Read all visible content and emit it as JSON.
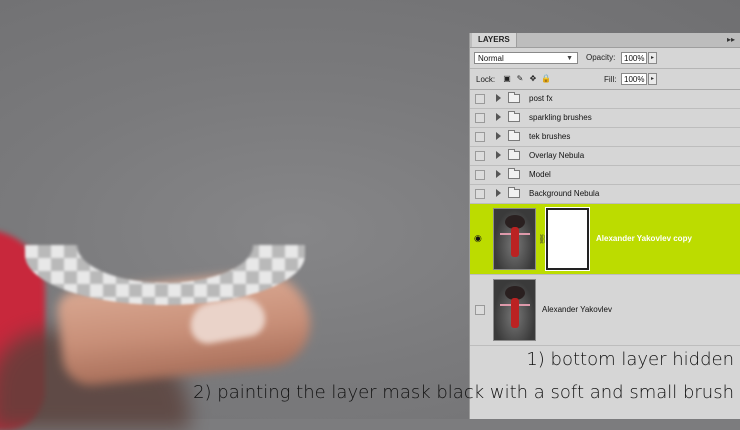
{
  "panel": {
    "tab_label": "LAYERS",
    "collapse_icon": "double-arrow-right",
    "blend_mode": "Normal",
    "opacity_label": "Opacity:",
    "opacity_value": "100%",
    "lock_label": "Lock:",
    "fill_label": "Fill:",
    "fill_value": "100%"
  },
  "groups": [
    {
      "name": "post fx"
    },
    {
      "name": "sparkling brushes"
    },
    {
      "name": "tek brushes"
    },
    {
      "name": "Overlay Nebula"
    },
    {
      "name": "Model"
    },
    {
      "name": "Background Nebula"
    }
  ],
  "layers": [
    {
      "name": "Alexander Yakovlev copy",
      "visible": true,
      "selected": true,
      "has_mask": true
    },
    {
      "name": "Alexander Yakovlev",
      "visible": false,
      "selected": false,
      "has_mask": false
    }
  ],
  "colors": {
    "selected_row": "#bcdc00",
    "panel_bg": "#d6d6d6"
  },
  "captions": {
    "line1": "1) bottom layer hidden",
    "line2": "2) painting the layer mask black with a soft and small brush"
  }
}
